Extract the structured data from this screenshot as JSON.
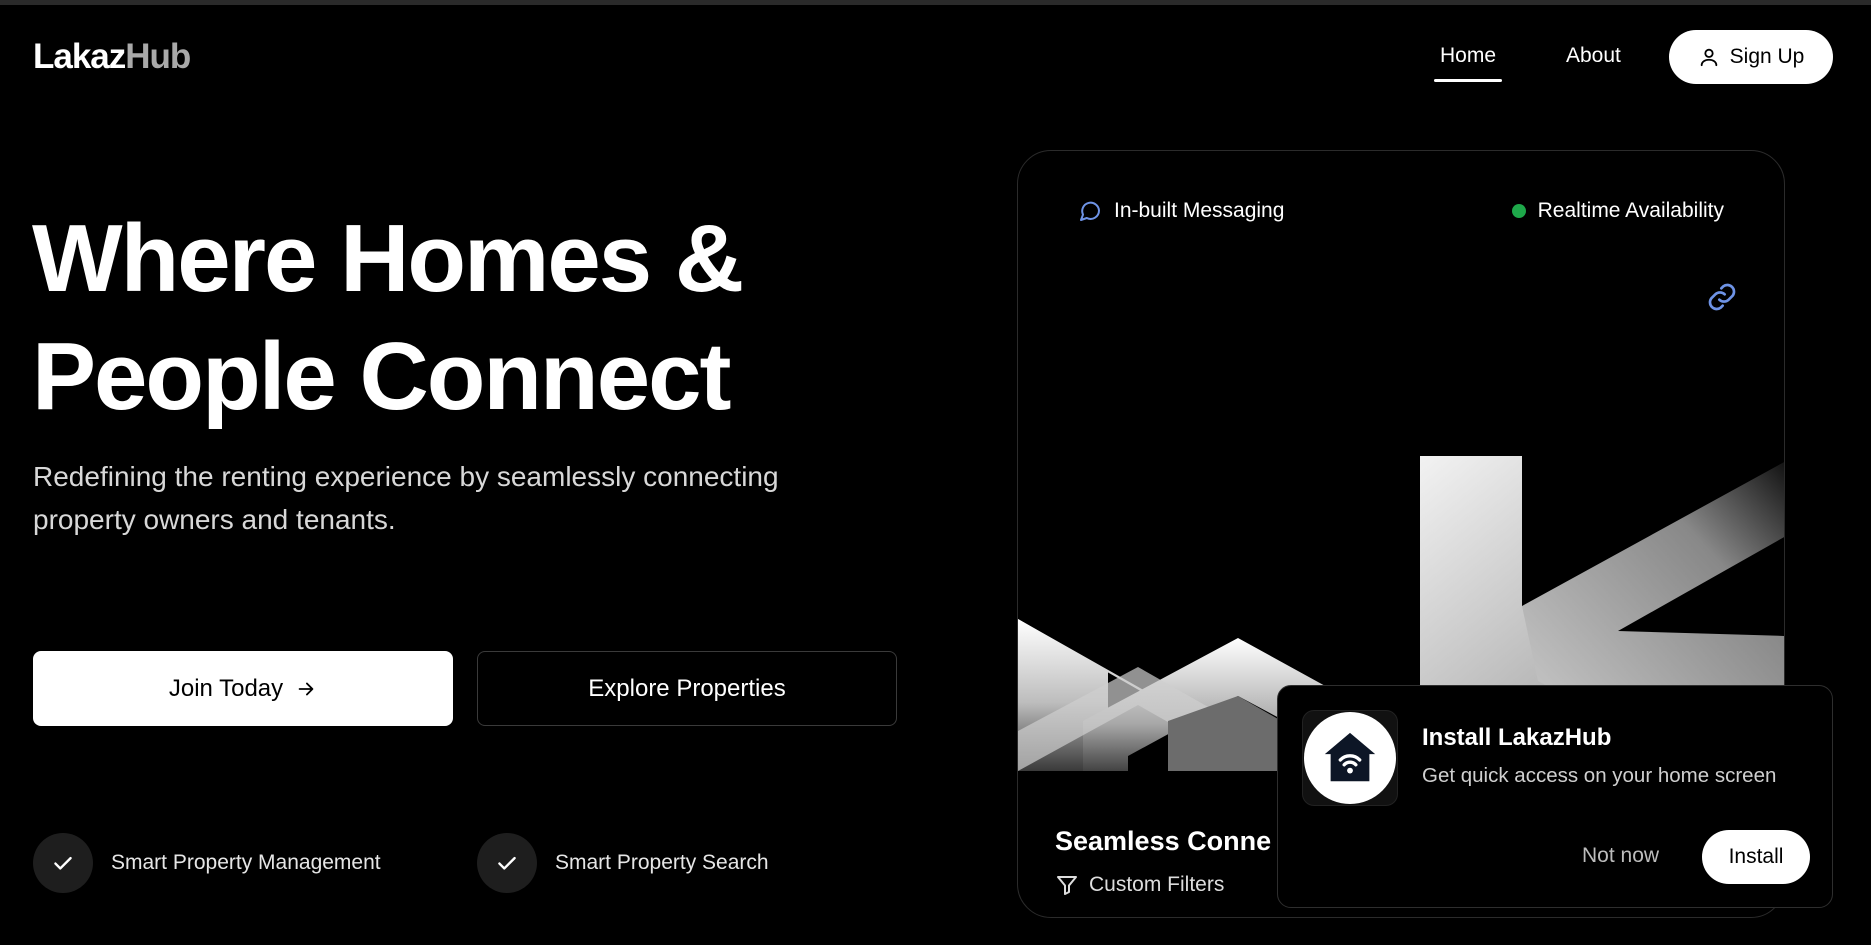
{
  "brand": {
    "part1": "Lakaz",
    "part2": "Hub"
  },
  "nav": {
    "home": "Home",
    "about": "About",
    "signup": "Sign Up"
  },
  "hero": {
    "title_line1": "Where Homes &",
    "title_line2": "People Connect",
    "subtitle": "Redefining the renting experience by seamlessly connecting property owners and tenants.",
    "join_label": "Join Today",
    "explore_label": "Explore Properties",
    "features": [
      "Smart Property Management",
      "Smart Property Search"
    ]
  },
  "card": {
    "badge_messaging": "In-built Messaging",
    "badge_realtime": "Realtime Availability",
    "title": "Seamless Conne",
    "filter_label": "Custom Filters"
  },
  "install_prompt": {
    "title": "Install LakazHub",
    "description": "Get quick access on your home screen",
    "dismiss_label": "Not now",
    "install_label": "Install"
  },
  "colors": {
    "background": "#000000",
    "primary_button": "#ffffff",
    "status_dot": "#1ea84a",
    "accent_icon": "#6e93e6"
  },
  "icons": [
    "user-icon",
    "arrow-right-icon",
    "check-icon",
    "message-icon",
    "link-icon",
    "filter-icon",
    "home-wifi-icon"
  ]
}
